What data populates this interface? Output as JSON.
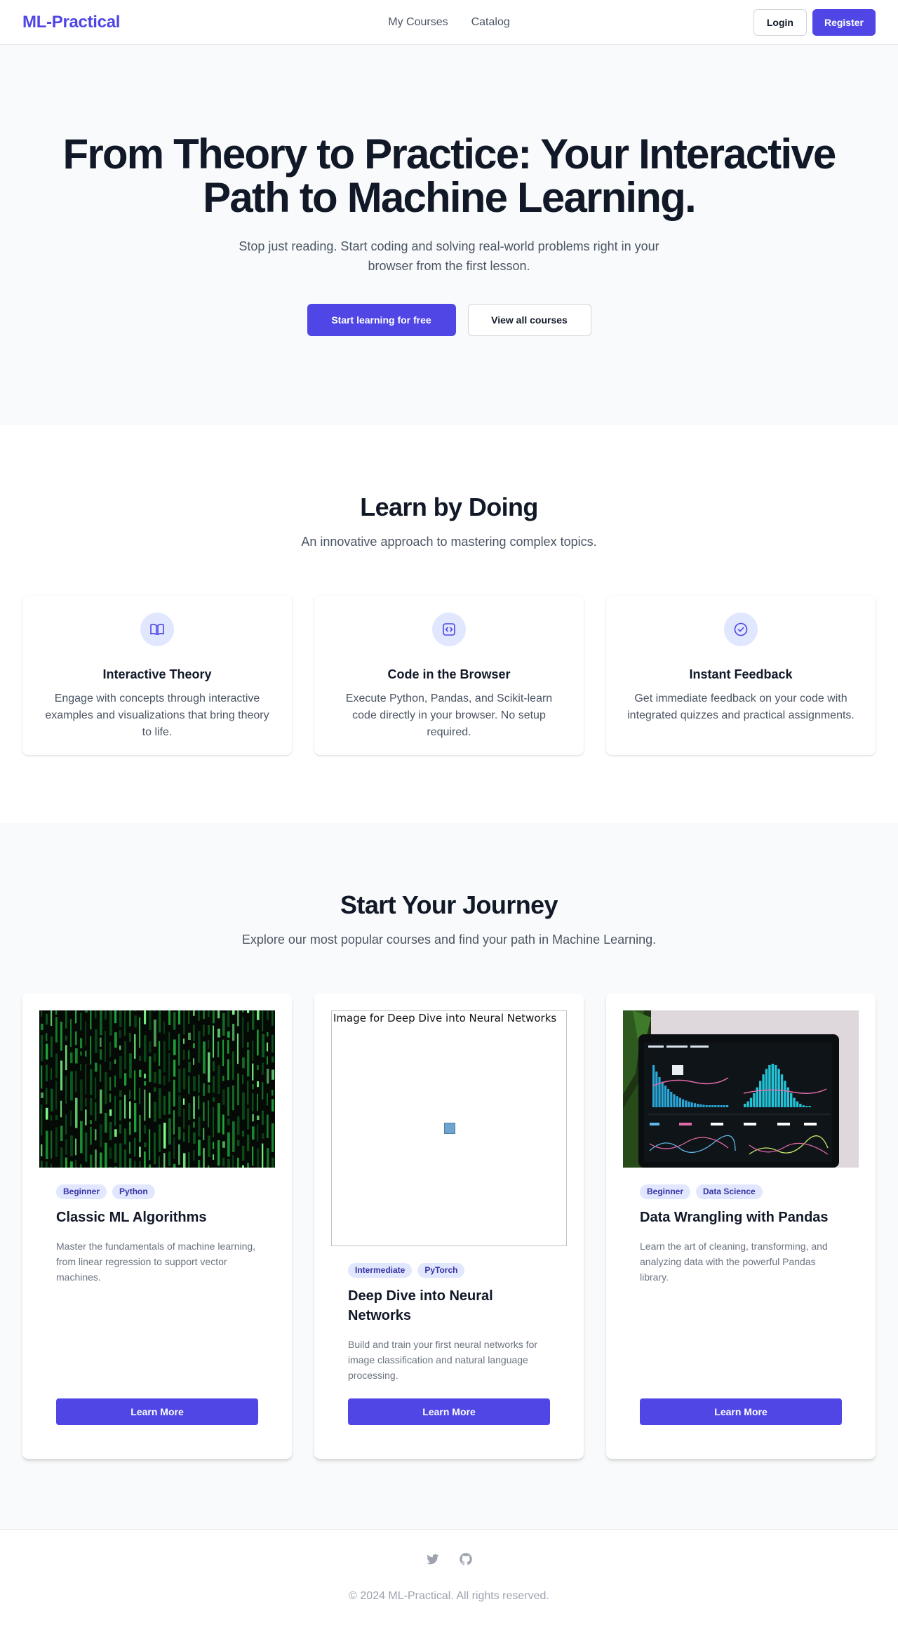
{
  "nav": {
    "brand": "ML-Practical",
    "links": [
      "My Courses",
      "Catalog"
    ],
    "login_label": "Login",
    "register_label": "Register"
  },
  "hero": {
    "title": "From Theory to Practice: Your Interactive Path to Machine Learning.",
    "subtitle": "Stop just reading. Start coding and solving real-world problems right in your browser from the first lesson.",
    "primary_cta": "Start learning for free",
    "secondary_cta": "View all courses"
  },
  "features": {
    "title": "Learn by Doing",
    "subtitle": "An innovative approach to mastering complex topics.",
    "items": [
      {
        "icon": "book-open-icon",
        "title": "Interactive Theory",
        "text": "Engage with concepts through interactive examples and visualizations that bring theory to life."
      },
      {
        "icon": "code-icon",
        "title": "Code in the Browser",
        "text": "Execute Python, Pandas, and Scikit-learn code directly in your browser. No setup required."
      },
      {
        "icon": "check-circle-icon",
        "title": "Instant Feedback",
        "text": "Get immediate feedback on your code with integrated quizzes and practical assignments."
      }
    ]
  },
  "courses": {
    "title": "Start Your Journey",
    "subtitle": "Explore our most popular courses and find your path in Machine Learning.",
    "items": [
      {
        "image": "matrix-code-image",
        "tags": [
          "Beginner",
          "Python"
        ],
        "title": "Classic ML Algorithms",
        "description": "Master the fundamentals of machine learning, from linear regression to support vector machines.",
        "button": "Learn More"
      },
      {
        "image_alt": "Image for Deep Dive into Neural Networks",
        "tags": [
          "Intermediate",
          "PyTorch"
        ],
        "title": "Deep Dive into Neural Networks",
        "description": "Build and train your first neural networks for image classification and natural language processing.",
        "button": "Learn More"
      },
      {
        "image": "analytics-dashboard-image",
        "tags": [
          "Beginner",
          "Data Science"
        ],
        "title": "Data Wrangling with Pandas",
        "description": "Learn the art of cleaning, transforming, and analyzing data with the powerful Pandas library.",
        "button": "Learn More"
      }
    ]
  },
  "footer": {
    "socials": [
      "twitter-icon",
      "github-icon"
    ],
    "copyright": "© 2024 ML-Practical. All rights reserved."
  },
  "colors": {
    "accent": "#4f46e5",
    "tag_bg": "#e0e7ff",
    "tag_text": "#3730a3",
    "heading": "#111827",
    "body_text": "#4b5563"
  }
}
